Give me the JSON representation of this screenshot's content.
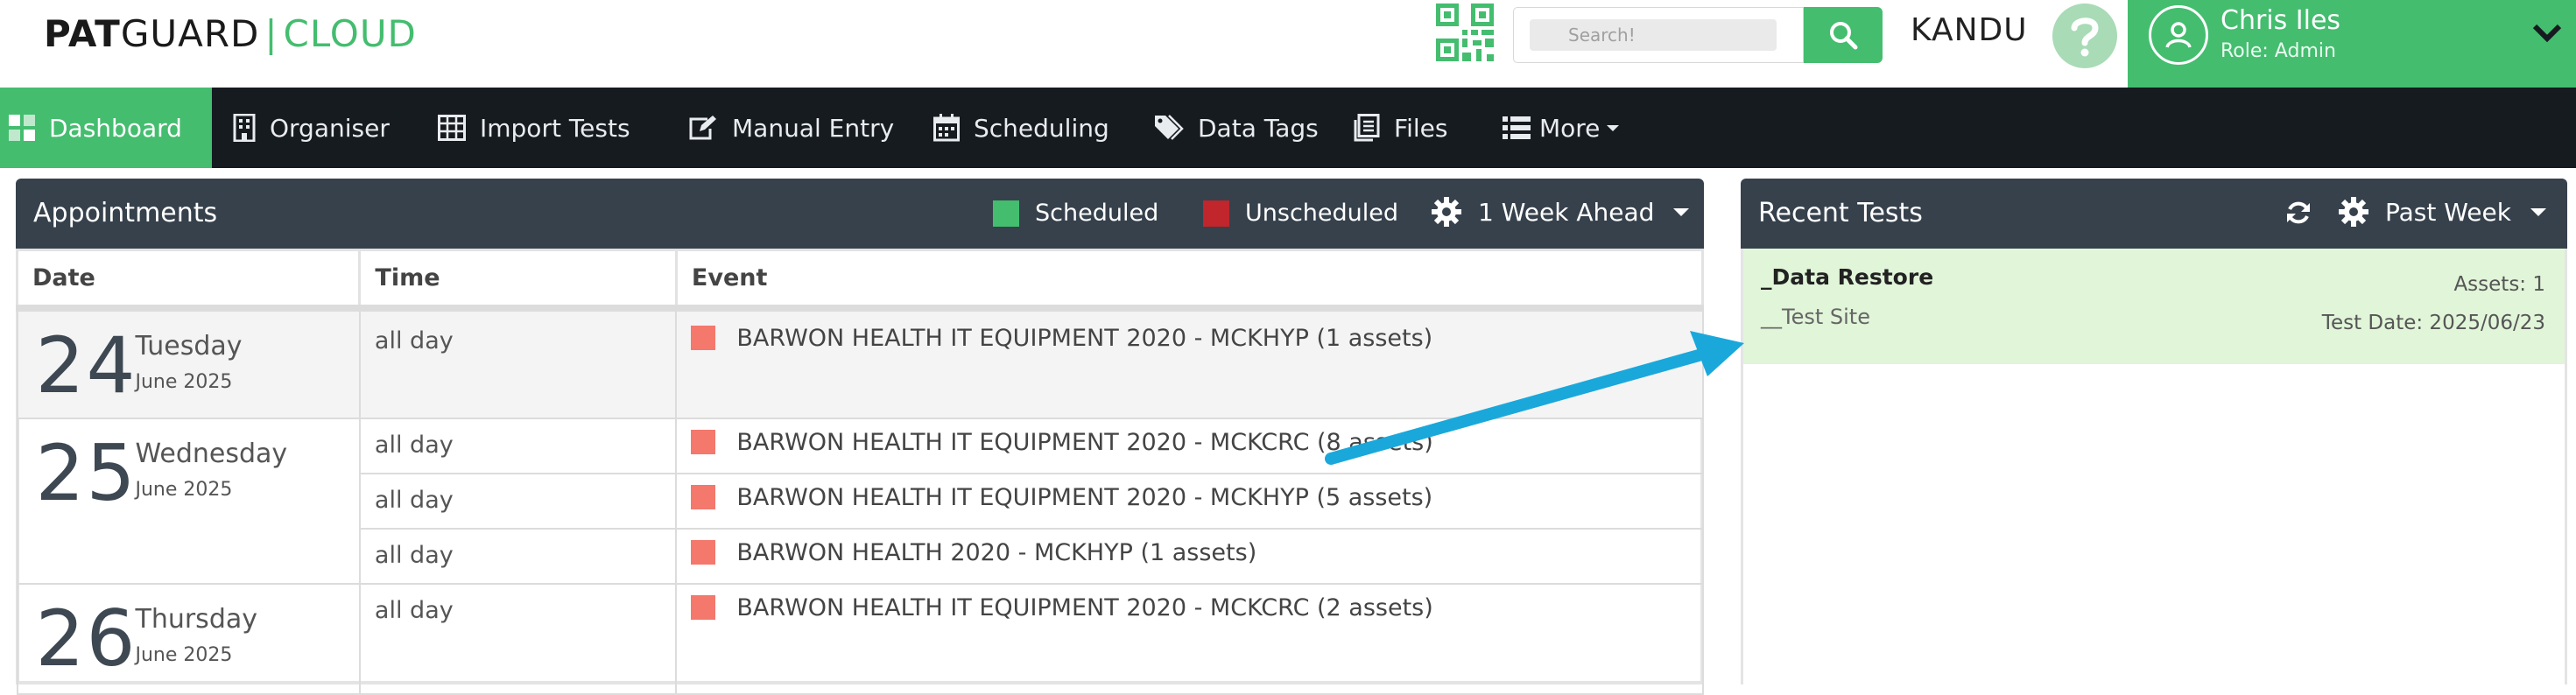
{
  "header": {
    "logo": {
      "pat": "PAT",
      "guard": "GUARD",
      "sep": "|",
      "cloud": "CLOUD"
    },
    "search": {
      "placeholder": "Search!"
    },
    "tenant": "KANDU",
    "user": {
      "name": "Chris Iles",
      "role": "Role: Admin"
    },
    "colors": {
      "brand": "#44bd6f",
      "nav_bg": "#161b20",
      "panel_head": "#36414c"
    }
  },
  "nav": {
    "items": [
      {
        "label": "Dashboard",
        "icon": "dashboard-icon",
        "active": true
      },
      {
        "label": "Organiser",
        "icon": "building-icon"
      },
      {
        "label": "Import Tests",
        "icon": "table-icon"
      },
      {
        "label": "Manual Entry",
        "icon": "edit-icon"
      },
      {
        "label": "Scheduling",
        "icon": "calendar-icon"
      },
      {
        "label": "Data Tags",
        "icon": "tags-icon"
      },
      {
        "label": "Files",
        "icon": "files-icon"
      },
      {
        "label": "More",
        "icon": "list-icon"
      }
    ]
  },
  "appointments": {
    "title": "Appointments",
    "legend": [
      {
        "label": "Scheduled",
        "color": "#44bd6f"
      },
      {
        "label": "Unscheduled",
        "color": "#c0262b"
      }
    ],
    "range": "1 Week Ahead",
    "columns": [
      "Date",
      "Time",
      "Event"
    ],
    "days": [
      {
        "num": "24",
        "day": "Tuesday",
        "month": "June 2025",
        "events": [
          {
            "time": "all day",
            "label": "BARWON HEALTH IT EQUIPMENT 2020 - MCKHYP (1 assets)"
          }
        ]
      },
      {
        "num": "25",
        "day": "Wednesday",
        "month": "June 2025",
        "events": [
          {
            "time": "all day",
            "label": "BARWON HEALTH IT EQUIPMENT 2020 - MCKCRC (8 assets)"
          },
          {
            "time": "all day",
            "label": "BARWON HEALTH IT EQUIPMENT 2020 - MCKHYP (5 assets)"
          },
          {
            "time": "all day",
            "label": "BARWON HEALTH 2020 - MCKHYP (1 assets)"
          }
        ]
      },
      {
        "num": "26",
        "day": "Thursday",
        "month": "June 2025",
        "events": [
          {
            "time": "all day",
            "label": "BARWON HEALTH IT EQUIPMENT 2020 - MCKCRC (2 assets)"
          }
        ]
      }
    ],
    "event_color": "#f4786c"
  },
  "recent": {
    "title": "Recent Tests",
    "range": "Past Week",
    "items": [
      {
        "title": "_Data Restore",
        "site": "__Test Site",
        "assets": "Assets: 1",
        "date": "Test Date: 2025/06/23"
      }
    ]
  },
  "annotation": {
    "arrow_color": "#1aa8db"
  }
}
